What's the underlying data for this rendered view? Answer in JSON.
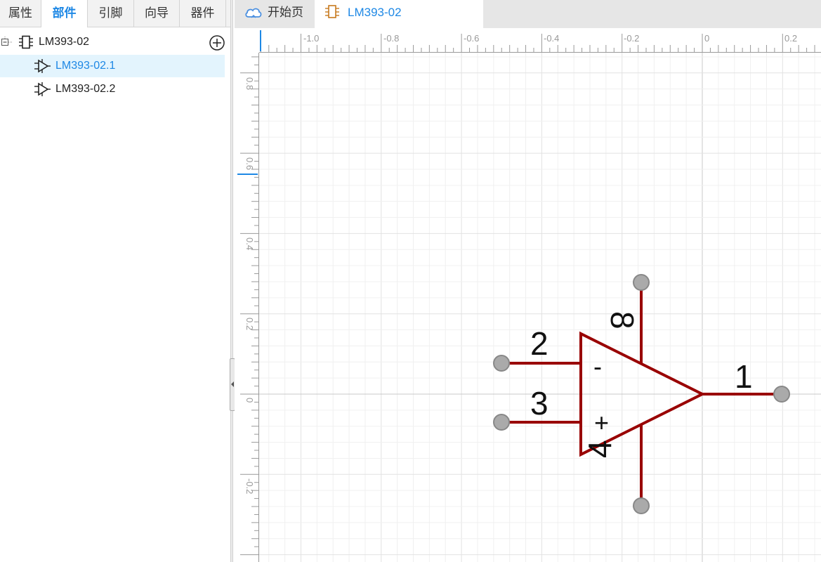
{
  "left_tabs": [
    {
      "label": "属性",
      "active": false
    },
    {
      "label": "部件",
      "active": true
    },
    {
      "label": "引脚",
      "active": false
    },
    {
      "label": "向导",
      "active": false
    },
    {
      "label": "器件",
      "active": false
    }
  ],
  "tree": {
    "root_label": "LM393-02",
    "parts": [
      {
        "label": "LM393-02.1",
        "selected": true
      },
      {
        "label": "LM393-02.2",
        "selected": false
      }
    ]
  },
  "doc_tabs": [
    {
      "label": "开始页",
      "icon": "cloud-icon",
      "active": false
    },
    {
      "label": "LM393-02",
      "icon": "chip-icon",
      "active": true
    }
  ],
  "ruler": {
    "top_labels": [
      "-1.0",
      "-0.8",
      "-0.6",
      "-0.4",
      "-0.2",
      "0",
      "0.2"
    ],
    "left_labels": [
      "0.8",
      "0.6",
      "0.4",
      "0.2",
      "0",
      "-0.2"
    ]
  },
  "symbol": {
    "pins": [
      "1",
      "2",
      "3",
      "4",
      "8"
    ],
    "minus_sign": "-",
    "plus_sign": "+"
  },
  "colors": {
    "accent": "#1e88e5",
    "symbol_stroke": "#990000",
    "pin_end": "#aaaaaa"
  }
}
